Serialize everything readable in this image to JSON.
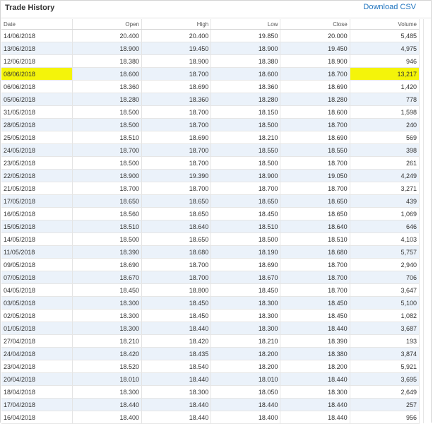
{
  "panel": {
    "title": "Trade History",
    "download_label": "Download CSV"
  },
  "table": {
    "headers": [
      "Date",
      "Open",
      "High",
      "Low",
      "Close",
      "Volume"
    ],
    "highlight_color": "#f4f40a",
    "rows": [
      [
        "14/06/2018",
        "20.400",
        "20.400",
        "19.850",
        "20.000",
        "5,485"
      ],
      [
        "13/06/2018",
        "18.900",
        "19.450",
        "18.900",
        "19.450",
        "4,975"
      ],
      [
        "12/06/2018",
        "18.380",
        "18.900",
        "18.380",
        "18.900",
        "946"
      ],
      [
        "08/06/2018",
        "18.600",
        "18.700",
        "18.600",
        "18.700",
        "13,217"
      ],
      [
        "06/06/2018",
        "18.360",
        "18.690",
        "18.360",
        "18.690",
        "1,420"
      ],
      [
        "05/06/2018",
        "18.280",
        "18.360",
        "18.280",
        "18.280",
        "778"
      ],
      [
        "31/05/2018",
        "18.500",
        "18.700",
        "18.150",
        "18.600",
        "1,598"
      ],
      [
        "28/05/2018",
        "18.500",
        "18.700",
        "18.500",
        "18.700",
        "240"
      ],
      [
        "25/05/2018",
        "18.510",
        "18.690",
        "18.210",
        "18.690",
        "569"
      ],
      [
        "24/05/2018",
        "18.700",
        "18.700",
        "18.550",
        "18.550",
        "398"
      ],
      [
        "23/05/2018",
        "18.500",
        "18.700",
        "18.500",
        "18.700",
        "261"
      ],
      [
        "22/05/2018",
        "18.900",
        "19.390",
        "18.900",
        "19.050",
        "4,249"
      ],
      [
        "21/05/2018",
        "18.700",
        "18.700",
        "18.700",
        "18.700",
        "3,271"
      ],
      [
        "17/05/2018",
        "18.650",
        "18.650",
        "18.650",
        "18.650",
        "439"
      ],
      [
        "16/05/2018",
        "18.560",
        "18.650",
        "18.450",
        "18.650",
        "1,069"
      ],
      [
        "15/05/2018",
        "18.510",
        "18.640",
        "18.510",
        "18.640",
        "646"
      ],
      [
        "14/05/2018",
        "18.500",
        "18.650",
        "18.500",
        "18.510",
        "4,103"
      ],
      [
        "11/05/2018",
        "18.390",
        "18.680",
        "18.190",
        "18.680",
        "5,757"
      ],
      [
        "09/05/2018",
        "18.690",
        "18.700",
        "18.690",
        "18.700",
        "2,940"
      ],
      [
        "07/05/2018",
        "18.670",
        "18.700",
        "18.670",
        "18.700",
        "706"
      ],
      [
        "04/05/2018",
        "18.450",
        "18.800",
        "18.450",
        "18.700",
        "3,647"
      ],
      [
        "03/05/2018",
        "18.300",
        "18.450",
        "18.300",
        "18.450",
        "5,100"
      ],
      [
        "02/05/2018",
        "18.300",
        "18.450",
        "18.300",
        "18.450",
        "1,082"
      ],
      [
        "01/05/2018",
        "18.300",
        "18.440",
        "18.300",
        "18.440",
        "3,687"
      ],
      [
        "27/04/2018",
        "18.210",
        "18.420",
        "18.210",
        "18.390",
        "193"
      ],
      [
        "24/04/2018",
        "18.420",
        "18.435",
        "18.200",
        "18.380",
        "3,874"
      ],
      [
        "23/04/2018",
        "18.520",
        "18.540",
        "18.200",
        "18.200",
        "5,921"
      ],
      [
        "20/04/2018",
        "18.010",
        "18.440",
        "18.010",
        "18.440",
        "3,695"
      ],
      [
        "18/04/2018",
        "18.300",
        "18.300",
        "18.050",
        "18.300",
        "2,649"
      ],
      [
        "17/04/2018",
        "18.440",
        "18.440",
        "18.440",
        "18.440",
        "257"
      ],
      [
        "16/04/2018",
        "18.400",
        "18.440",
        "18.400",
        "18.440",
        "956"
      ]
    ]
  }
}
